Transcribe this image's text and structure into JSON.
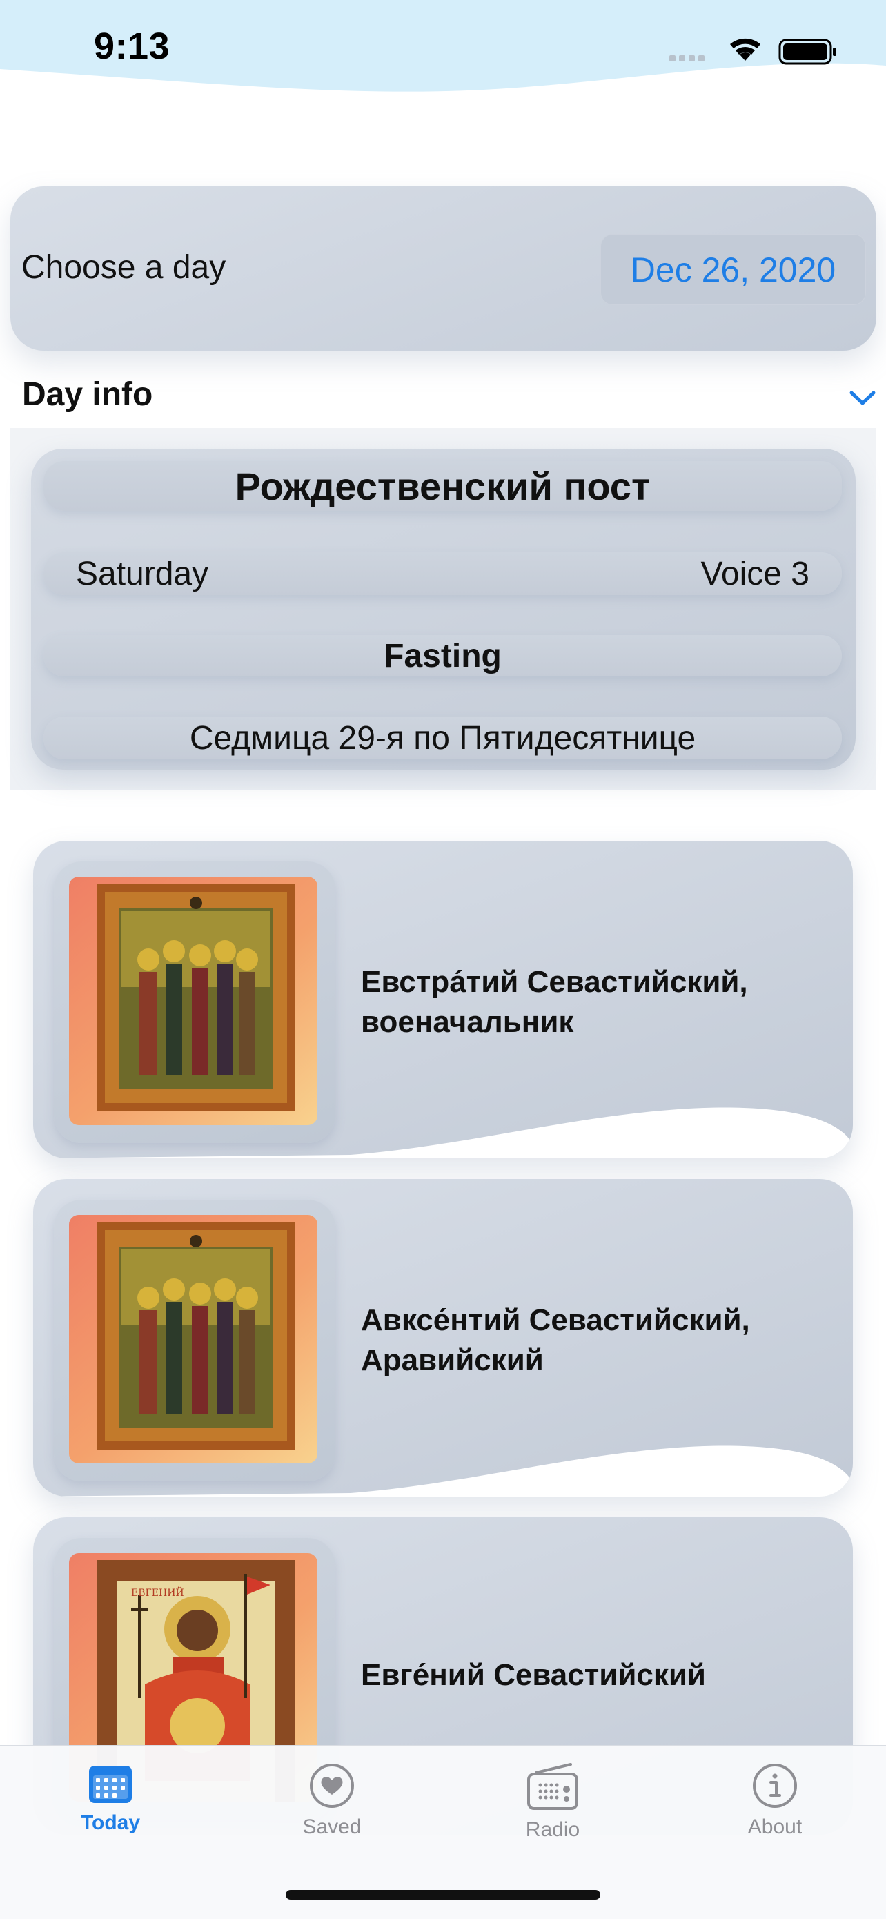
{
  "status_bar": {
    "time": "9:13"
  },
  "date_picker": {
    "label": "Choose a day",
    "value": "Dec 26, 2020"
  },
  "day_info": {
    "header": "Day info",
    "title": "Рождественский пост",
    "weekday": "Saturday",
    "voice": "Voice 3",
    "fasting": "Fasting",
    "week": "Седмица 29-я по Пятидесятнице"
  },
  "saints": [
    {
      "name": "Евстра́тий Севастийский, военачальник",
      "icon": "saints-group-icon"
    },
    {
      "name": "Авксе́нтий Севастийский, Аравийский",
      "icon": "saints-group-icon"
    },
    {
      "name": "Евге́ний Севастийский",
      "icon": "saint-single-icon"
    }
  ],
  "tab_bar": {
    "tabs": [
      {
        "label": "Today",
        "icon": "calendar-icon",
        "active": true
      },
      {
        "label": "Saved",
        "icon": "heart-icon",
        "active": false
      },
      {
        "label": "Radio",
        "icon": "radio-icon",
        "active": false
      },
      {
        "label": "About",
        "icon": "info-icon",
        "active": false
      }
    ]
  },
  "colors": {
    "accent": "#1e7ee6",
    "card": "#c8d0db",
    "status_bar_bg": "#d5eefa"
  }
}
